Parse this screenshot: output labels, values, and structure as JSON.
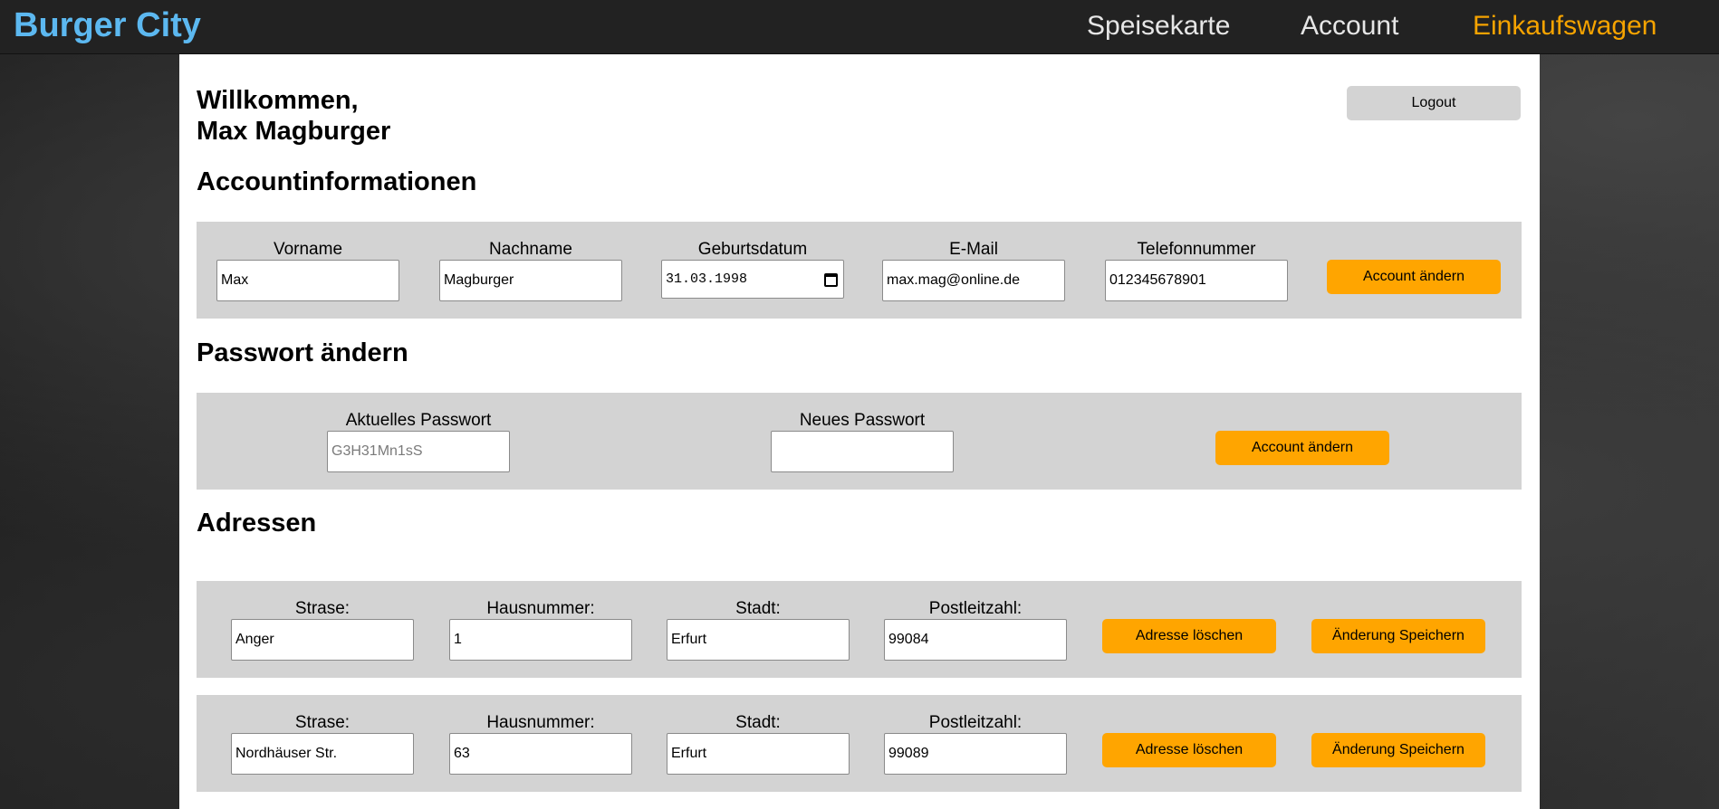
{
  "nav": {
    "brand": "Burger City",
    "links": [
      "Speisekarte",
      "Account",
      "Einkaufswagen"
    ]
  },
  "welcome": "Willkommen,\nMax Magburger",
  "logout_label": "Logout",
  "account_section": {
    "title": "Accountinformationen",
    "fields": [
      {
        "label": "Vorname",
        "value": "Max"
      },
      {
        "label": "Nachname",
        "value": "Magburger"
      },
      {
        "label": "Geburtsdatum",
        "value": "31.03.1998"
      },
      {
        "label": "E-Mail",
        "value": "max.mag@online.de"
      },
      {
        "label": "Telefonnummer",
        "value": "012345678901"
      }
    ],
    "button": "Account ändern"
  },
  "password_section": {
    "title": "Passwort ändern",
    "current_label": "Aktuelles Passwort",
    "current_placeholder": "G3H31Mn1sS",
    "new_label": "Neues Passwort",
    "new_value": "",
    "button": "Account ändern"
  },
  "address_section": {
    "title": "Adressen",
    "labels": {
      "street": "Strase:",
      "number": "Hausnummer:",
      "city": "Stadt:",
      "zip": "Postleitzahl:"
    },
    "delete_label": "Adresse löschen",
    "save_label": "Änderung Speichern",
    "addresses": [
      {
        "street": "Anger",
        "number": "1",
        "city": "Erfurt",
        "zip": "99084"
      },
      {
        "street": "Nordhäuser Str.",
        "number": "63",
        "city": "Erfurt",
        "zip": "99089"
      }
    ]
  },
  "colors": {
    "brand": "#5cb8f0",
    "accent": "#ffa500",
    "active_nav": "#f5a300",
    "panel": "#d3d3d3"
  },
  "icons": {
    "date_picker": "calendar-icon"
  }
}
